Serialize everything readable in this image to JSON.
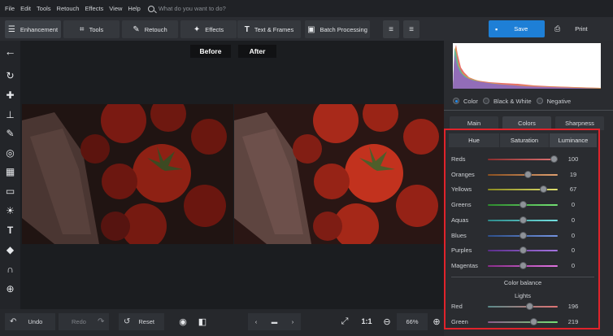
{
  "menu": [
    "File",
    "Edit",
    "Tools",
    "Retouch",
    "Effects",
    "View",
    "Help"
  ],
  "search": {
    "placeholder": "What do you want to do?"
  },
  "tabs": [
    {
      "label": "Enhancement",
      "icon": "sliders-icon"
    },
    {
      "label": "Tools",
      "icon": "crop-icon"
    },
    {
      "label": "Retouch",
      "icon": "brush-icon"
    },
    {
      "label": "Effects",
      "icon": "wand-icon"
    },
    {
      "label": "Text & Frames",
      "icon": "text-icon"
    },
    {
      "label": "Batch Processing",
      "icon": "images-icon"
    }
  ],
  "actions": {
    "save": "Save",
    "print": "Print"
  },
  "canvas": {
    "before": "Before",
    "after": "After"
  },
  "bottom": {
    "undo": "Undo",
    "redo": "Redo",
    "reset": "Reset",
    "zoom_fit": "1:1",
    "zoom": "66%"
  },
  "mode": {
    "color": "Color",
    "bw": "Black & White",
    "negative": "Negative",
    "selected": "Color"
  },
  "subtabs": {
    "main": "Main",
    "colors": "Colors",
    "sharpness": "Sharpness",
    "active": "Colors"
  },
  "hsl_tabs": {
    "hue": "Hue",
    "saturation": "Saturation",
    "luminance": "Luminance",
    "active": "Luminance"
  },
  "luminance": [
    {
      "label": "Reds",
      "value": "100",
      "pos": 0.95,
      "c1": "#8a2d2d",
      "c2": "#e07474"
    },
    {
      "label": "Oranges",
      "value": "19",
      "pos": 0.58,
      "c1": "#8a5020",
      "c2": "#e0a070"
    },
    {
      "label": "Yellows",
      "value": "67",
      "pos": 0.8,
      "c1": "#8a8a20",
      "c2": "#e0e070"
    },
    {
      "label": "Greens",
      "value": "0",
      "pos": 0.5,
      "c1": "#2d8a2d",
      "c2": "#74e074"
    },
    {
      "label": "Aquas",
      "value": "0",
      "pos": 0.5,
      "c1": "#2d8a8a",
      "c2": "#74e0e0"
    },
    {
      "label": "Blues",
      "value": "0",
      "pos": 0.5,
      "c1": "#2d4f8a",
      "c2": "#7494e0"
    },
    {
      "label": "Purples",
      "value": "0",
      "pos": 0.5,
      "c1": "#5a2d8a",
      "c2": "#a474e0"
    },
    {
      "label": "Magentas",
      "value": "0",
      "pos": 0.5,
      "c1": "#8a2d8a",
      "c2": "#e074e0"
    }
  ],
  "color_balance": {
    "title": "Color balance",
    "subtitle": "Lights",
    "sliders": [
      {
        "label": "Red",
        "value": "196",
        "pos": 0.6,
        "c1": "#5a8a8a",
        "c2": "#e07474"
      },
      {
        "label": "Green",
        "value": "219",
        "pos": 0.66,
        "c1": "#8a5a8a",
        "c2": "#74e074"
      }
    ]
  },
  "colors": {
    "accent": "#1e7fd6",
    "highlight_box": "#e0232b"
  }
}
